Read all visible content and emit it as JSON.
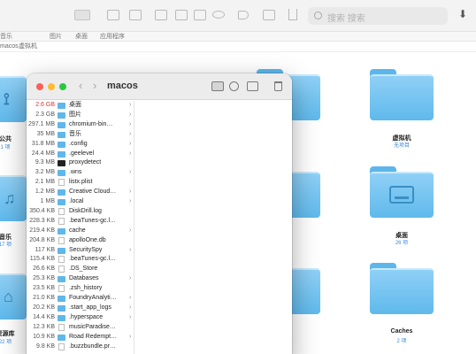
{
  "background_window": {
    "search_placeholder": "搜索 搜索",
    "tabs": [
      "音乐",
      "图片",
      "桌面",
      "应用程序"
    ],
    "path": [
      "macos",
      "虚拟机"
    ],
    "folders": [
      {
        "name": "公共",
        "sub": "1 项"
      },
      {
        "name": "音乐",
        "sub": "17 项"
      },
      {
        "name": "资源库",
        "sub": "22 项"
      },
      {
        "name": "虚拟机",
        "sub": "无项目"
      },
      {
        "name": "桌面",
        "sub": "26 项"
      },
      {
        "name": "Caches",
        "sub": "2 项"
      }
    ]
  },
  "window": {
    "title": "macos",
    "rows": [
      {
        "size": "2.6 GB",
        "name": "桌面",
        "icon": "folder",
        "chevron": true,
        "size_red": true
      },
      {
        "size": "2.3 GB",
        "name": "图片",
        "icon": "folder",
        "chevron": true
      },
      {
        "size": "297.1 MB",
        "name": "chromium-bin…",
        "icon": "folder",
        "chevron": true
      },
      {
        "size": "35 MB",
        "name": "音乐",
        "icon": "folder",
        "chevron": true
      },
      {
        "size": "31.8 MB",
        "name": ".config",
        "icon": "folder",
        "chevron": true
      },
      {
        "size": "24.4 MB",
        "name": ".geelevel",
        "icon": "folder",
        "chevron": true
      },
      {
        "size": "9.3 MB",
        "name": "proxydetect",
        "icon": "terminal",
        "chevron": false
      },
      {
        "size": "3.2 MB",
        "name": ".wns",
        "icon": "folder",
        "chevron": true
      },
      {
        "size": "2.1 MB",
        "name": "listx.plist",
        "icon": "doc",
        "chevron": false
      },
      {
        "size": "1.2 MB",
        "name": "Creative Cloud…",
        "icon": "folder",
        "chevron": true
      },
      {
        "size": "1 MB",
        "name": ".local",
        "icon": "folder",
        "chevron": true
      },
      {
        "size": "350.4 KB",
        "name": "DiskDrill.log",
        "icon": "doc",
        "chevron": false
      },
      {
        "size": "228.3 KB",
        "name": ".beaTunes-gc.l…",
        "icon": "doc",
        "chevron": false
      },
      {
        "size": "219.4 KB",
        "name": "cache",
        "icon": "folder",
        "chevron": true
      },
      {
        "size": "204.8 KB",
        "name": "apolloOne.db",
        "icon": "doc",
        "chevron": false
      },
      {
        "size": "117 KB",
        "name": "SecuritySpy",
        "icon": "folder",
        "chevron": true
      },
      {
        "size": "115.4 KB",
        "name": ".beaTunes-gc.l…",
        "icon": "doc",
        "chevron": false
      },
      {
        "size": "26.6 KB",
        "name": ".DS_Store",
        "icon": "doc",
        "chevron": false
      },
      {
        "size": "25.3 KB",
        "name": "Databases",
        "icon": "folder",
        "chevron": true
      },
      {
        "size": "23.5 KB",
        "name": ".zsh_history",
        "icon": "doc",
        "chevron": false
      },
      {
        "size": "21.0 KB",
        "name": "FoundryAnalyti…",
        "icon": "folder",
        "chevron": true
      },
      {
        "size": "20.2 KB",
        "name": ".start_app_logs",
        "icon": "folder",
        "chevron": true
      },
      {
        "size": "14.4 KB",
        "name": ".hyperspace",
        "icon": "folder",
        "chevron": true
      },
      {
        "size": "12.3 KB",
        "name": "musicParadise…",
        "icon": "doc",
        "chevron": false
      },
      {
        "size": "10.9 KB",
        "name": "Road Redempt…",
        "icon": "folder",
        "chevron": true
      },
      {
        "size": "9.8 KB",
        "name": ".buzzbundle.pr…",
        "icon": "doc",
        "chevron": false
      }
    ]
  },
  "colors": {
    "folder": "#5fb9ec",
    "close": "#ff5f57",
    "minimize": "#febc2e",
    "zoom": "#28c840",
    "size_highlight": "#dd3333"
  },
  "icons": {
    "chevron": "›",
    "back": "‹",
    "forward": "›",
    "download": "⬇"
  }
}
